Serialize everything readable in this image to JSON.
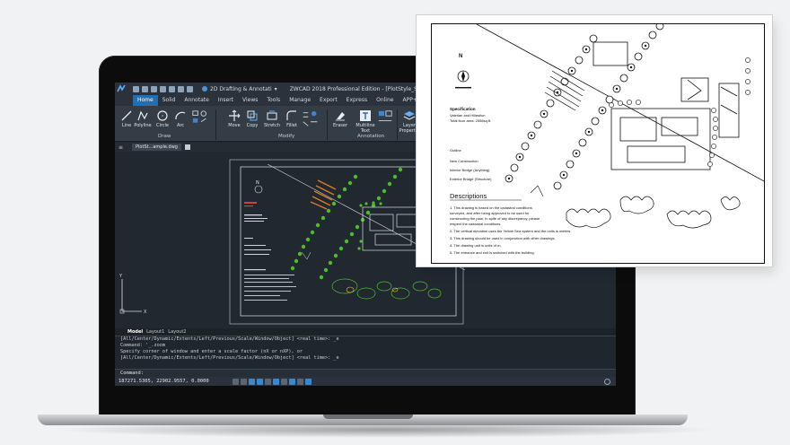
{
  "app": {
    "workspace": "2D Drafting & Annotati",
    "window_title": "ZWCAD 2018 Professional Edition - [PlotStyle_Sampl"
  },
  "ribbon": {
    "tabs": [
      {
        "label": "Home",
        "active": true
      },
      {
        "label": "Solid",
        "active": false
      },
      {
        "label": "Annotate",
        "active": false
      },
      {
        "label": "Insert",
        "active": false
      },
      {
        "label": "Views",
        "active": false
      },
      {
        "label": "Tools",
        "active": false
      },
      {
        "label": "Manage",
        "active": false
      },
      {
        "label": "Export",
        "active": false
      },
      {
        "label": "Express",
        "active": false
      },
      {
        "label": "Online",
        "active": false
      },
      {
        "label": "APP+",
        "active": false
      }
    ],
    "draw": {
      "line": "Line",
      "polyline": "Polyline",
      "circle": "Circle",
      "arc": "Arc",
      "panel_label": "Draw"
    },
    "modify": {
      "move": "Move",
      "copy": "Copy",
      "stretch": "Stretch",
      "fillet": "Fillet",
      "panel_label": "Modify"
    },
    "annotation": {
      "eraser": "Eraser",
      "mtext_line1": "Multiline",
      "mtext_line2": "Text",
      "panel_label": "Annotation"
    },
    "layers": {
      "label_line1": "Layer",
      "label_line2": "Propertie"
    }
  },
  "document_tab": "PlotSt...ample.dwg",
  "layout_tabs": {
    "model": "Model",
    "layout1": "Layout1",
    "layout2": "Layout2"
  },
  "command": {
    "lines": [
      "[All/Center/Dynamic/Extents/Left/Previous/Scale/Window/Object] <real time>: _e",
      "Command: '_.zoom",
      "Specify corner of window and enter a scale factor (nX or nXP), or",
      "[All/Center/Dynamic/Extents/Left/Previous/Scale/Window/Object] <real time>: _e"
    ],
    "prompt": "Command:"
  },
  "status": {
    "coordinates": "187271.5305, 22902.9557, 0.0000"
  },
  "paper": {
    "north": "N",
    "heading": "Descriptions",
    "spec_title": "Specification",
    "spec_l1": "Valerian and Hillestion",
    "spec_l2": "Total floor area: 2558sq.ft.",
    "outline": "Outline",
    "new_construction": "New Construction",
    "interior_bridge": "Interior Bridge (Anything)",
    "exterior_bridge": "Exterior Bridge (Structure)",
    "desc1": "1. This drawing is based on the cadastral conditions",
    "desc1b": "surveyed, and after being approved to be used for",
    "desc1c": "constructing the plan. In spite of any discrepancy, please",
    "desc1d": "respect the cadastral conditions.",
    "desc2": "2. The vertical elevation uses the Yellow Sea system and the units is meters.",
    "desc3": "3. This drawing should be used in conjunction with other drawings.",
    "desc4": "4. The drawing unit is units of m.",
    "desc5": "5. The entrance and exit is switched with the building."
  },
  "colors": {
    "accent": "#1f6fb5",
    "hedge": "#4fbd2a",
    "roof": "#e07b27",
    "canvas": "#212830"
  }
}
